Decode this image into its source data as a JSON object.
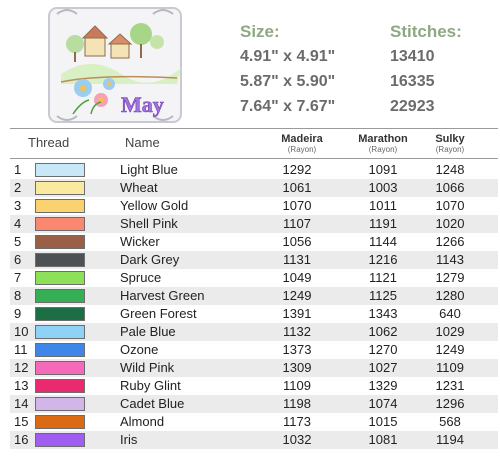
{
  "artwork": {
    "label": "May"
  },
  "sizes": {
    "header": "Size:",
    "values": [
      "4.91\" x 4.91\"",
      "5.87\" x 5.90\"",
      "7.64\" x 7.67\""
    ]
  },
  "stitches": {
    "header": "Stitches:",
    "values": [
      "13410",
      "16335",
      "22923"
    ]
  },
  "columns": {
    "thread": "Thread",
    "name": "Name",
    "madeira": "Madeira",
    "marathon": "Marathon",
    "sulky": "Sulky",
    "rayon": "(Rayon)"
  },
  "rows": [
    {
      "num": "1",
      "color": "#c8e8f8",
      "name": "Light Blue",
      "madeira": "1292",
      "marathon": "1091",
      "sulky": "1248"
    },
    {
      "num": "2",
      "color": "#faeaa0",
      "name": "Wheat",
      "madeira": "1061",
      "marathon": "1003",
      "sulky": "1066"
    },
    {
      "num": "3",
      "color": "#fbd270",
      "name": "Yellow Gold",
      "madeira": "1070",
      "marathon": "1011",
      "sulky": "1070"
    },
    {
      "num": "4",
      "color": "#fa8870",
      "name": "Shell Pink",
      "madeira": "1107",
      "marathon": "1191",
      "sulky": "1020"
    },
    {
      "num": "5",
      "color": "#9a6047",
      "name": "Wicker",
      "madeira": "1056",
      "marathon": "1144",
      "sulky": "1266"
    },
    {
      "num": "6",
      "color": "#4b5154",
      "name": "Dark Grey",
      "madeira": "1131",
      "marathon": "1216",
      "sulky": "1143"
    },
    {
      "num": "7",
      "color": "#8ce05a",
      "name": "Spruce",
      "madeira": "1049",
      "marathon": "1121",
      "sulky": "1279"
    },
    {
      "num": "8",
      "color": "#35ae55",
      "name": "Harvest Green",
      "madeira": "1249",
      "marathon": "1125",
      "sulky": "1280"
    },
    {
      "num": "9",
      "color": "#1e6e45",
      "name": "Green Forest",
      "madeira": "1391",
      "marathon": "1343",
      "sulky": "640"
    },
    {
      "num": "10",
      "color": "#8ed2f6",
      "name": "Pale Blue",
      "madeira": "1132",
      "marathon": "1062",
      "sulky": "1029"
    },
    {
      "num": "11",
      "color": "#3e86e8",
      "name": "Ozone",
      "madeira": "1373",
      "marathon": "1270",
      "sulky": "1249"
    },
    {
      "num": "12",
      "color": "#f56ab8",
      "name": "Wild Pink",
      "madeira": "1309",
      "marathon": "1027",
      "sulky": "1109"
    },
    {
      "num": "13",
      "color": "#ea2a6e",
      "name": "Ruby Glint",
      "madeira": "1109",
      "marathon": "1329",
      "sulky": "1231"
    },
    {
      "num": "14",
      "color": "#d2b6ea",
      "name": "Cadet Blue",
      "madeira": "1198",
      "marathon": "1074",
      "sulky": "1296"
    },
    {
      "num": "15",
      "color": "#dc6a14",
      "name": "Almond",
      "madeira": "1173",
      "marathon": "1015",
      "sulky": "568"
    },
    {
      "num": "16",
      "color": "#a05ef0",
      "name": "Iris",
      "madeira": "1032",
      "marathon": "1081",
      "sulky": "1194"
    }
  ]
}
